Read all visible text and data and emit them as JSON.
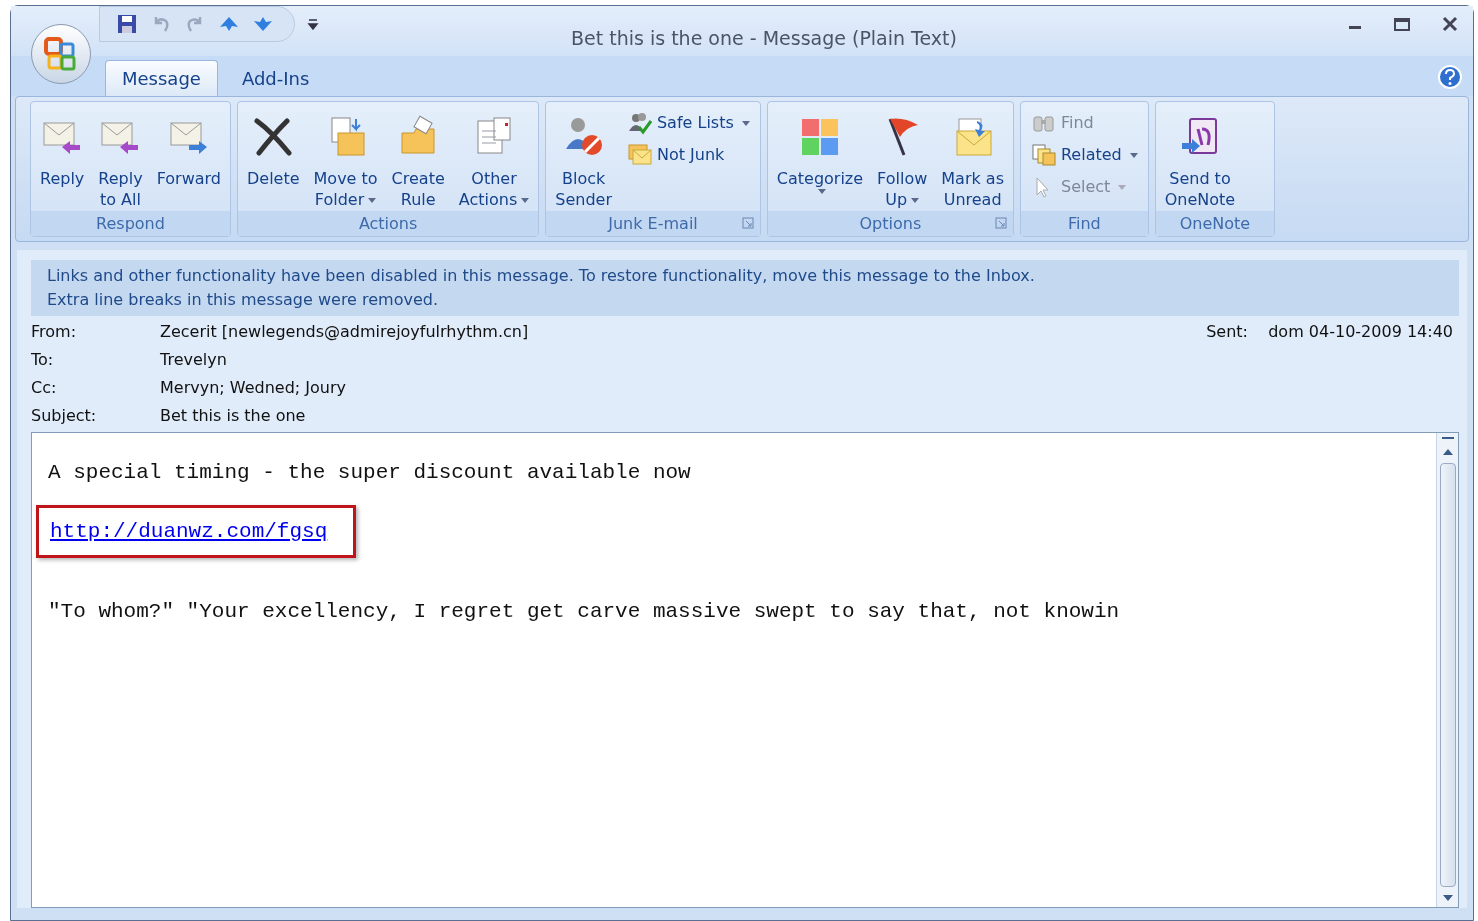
{
  "window": {
    "title": "Bet this is the one - Message (Plain Text)"
  },
  "tabs": [
    {
      "label": "Message",
      "selected": true
    },
    {
      "label": "Add-Ins",
      "selected": false
    }
  ],
  "ribbon": [
    {
      "name": "Respond",
      "launcher": false,
      "items": [
        {
          "kind": "large",
          "lines": [
            "Reply"
          ],
          "dropdown": false
        },
        {
          "kind": "large",
          "lines": [
            "Reply",
            "to All"
          ],
          "dropdown": false
        },
        {
          "kind": "large",
          "lines": [
            "Forward"
          ],
          "dropdown": false
        }
      ]
    },
    {
      "name": "Actions",
      "launcher": false,
      "items": [
        {
          "kind": "large",
          "lines": [
            "Delete"
          ],
          "dropdown": false
        },
        {
          "kind": "large",
          "lines": [
            "Move to",
            "Folder"
          ],
          "dropdown": true
        },
        {
          "kind": "large",
          "lines": [
            "Create",
            "Rule"
          ],
          "dropdown": false
        },
        {
          "kind": "large",
          "lines": [
            "Other",
            "Actions"
          ],
          "dropdown": true
        }
      ]
    },
    {
      "name": "Junk E-mail",
      "launcher": true,
      "items": [
        {
          "kind": "large",
          "lines": [
            "Block",
            "Sender"
          ],
          "dropdown": false
        },
        {
          "kind": "stack",
          "buttons": [
            {
              "label": "Safe Lists",
              "dropdown": true,
              "disabled": false
            },
            {
              "label": "Not Junk",
              "dropdown": false,
              "disabled": false
            }
          ]
        }
      ]
    },
    {
      "name": "Options",
      "launcher": true,
      "items": [
        {
          "kind": "large",
          "lines": [
            "Categorize"
          ],
          "dropdown": true
        },
        {
          "kind": "large",
          "lines": [
            "Follow",
            "Up"
          ],
          "dropdown": true
        },
        {
          "kind": "large",
          "lines": [
            "Mark as",
            "Unread"
          ],
          "dropdown": false
        }
      ]
    },
    {
      "name": "Find",
      "launcher": false,
      "items": [
        {
          "kind": "stack",
          "buttons": [
            {
              "label": "Find",
              "dropdown": false,
              "disabled": true
            },
            {
              "label": "Related",
              "dropdown": true,
              "disabled": false
            },
            {
              "label": "Select",
              "dropdown": true,
              "disabled": true
            }
          ]
        }
      ]
    },
    {
      "name": "OneNote",
      "launcher": false,
      "items": [
        {
          "kind": "large",
          "lines": [
            "Send to",
            "OneNote"
          ],
          "dropdown": false
        }
      ]
    }
  ],
  "infobar": [
    "Links and other functionality have been disabled in this message. To restore functionality, move this message to the Inbox.",
    "Extra line breaks in this message were removed."
  ],
  "headers": {
    "from": {
      "label": "From:",
      "value": "Zecerit [newlegends@admirejoyfulrhythm.cn]"
    },
    "sent": {
      "label": "Sent:",
      "value": "dom 04-10-2009 14:40"
    },
    "to": {
      "label": "To:",
      "value": "Trevelyn"
    },
    "cc": {
      "label": "Cc:",
      "value": "Mervyn; Wedned; Joury"
    },
    "subject": {
      "label": "Subject:",
      "value": "Bet this is the one"
    }
  },
  "body": [
    {
      "kind": "text",
      "text": "A special timing - the super discount available now"
    },
    {
      "kind": "link",
      "text": "http://duanwz.com/fgsq",
      "highlighted": true
    },
    {
      "kind": "text",
      "text": "\"To whom?\" \"Your excellency, I regret get carve massive swept to say that, not knowin"
    }
  ]
}
